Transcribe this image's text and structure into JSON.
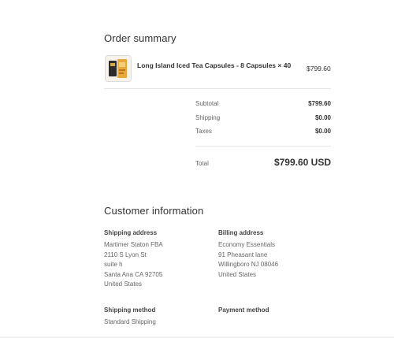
{
  "order_summary": {
    "title": "Order summary",
    "item": {
      "name": "Long Island Iced Tea Capsules - 8 Capsules × 40",
      "price": "$799.60",
      "thumbnail_icon": "product-thumbnail-icon"
    },
    "rows": [
      {
        "label": "Subtotal",
        "value": "$799.60"
      },
      {
        "label": "Shipping",
        "value": "$0.00"
      },
      {
        "label": "Taxes",
        "value": "$0.00"
      }
    ],
    "total": {
      "label": "Total",
      "value": "$799.60 USD"
    }
  },
  "customer_information": {
    "title": "Customer information",
    "shipping_address": {
      "title": "Shipping address",
      "lines": [
        "Martimer Staton FBA",
        "2110 S Lyon St",
        "suite h",
        "Santa Ana CA 92705",
        "United States"
      ]
    },
    "billing_address": {
      "title": "Billing address",
      "lines": [
        "Economy Essentials",
        "91 Pheasant lane",
        "Willingboro NJ 08046",
        "United States"
      ]
    },
    "shipping_method": {
      "title": "Shipping method",
      "value": "Standard Shipping"
    },
    "payment_method": {
      "title": "Payment method"
    }
  },
  "colors": {
    "text": "#333333",
    "muted": "#666666",
    "divider": "#e6e6e6"
  }
}
